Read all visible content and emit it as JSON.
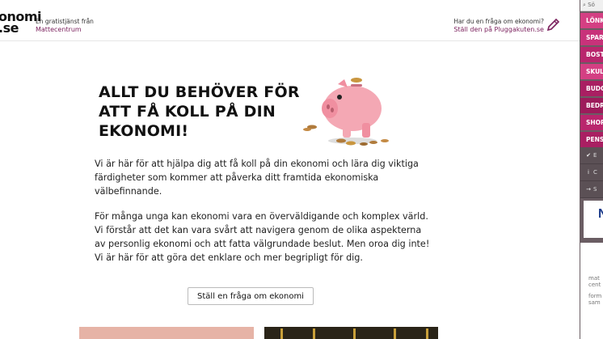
{
  "header": {
    "logo_line1": "onomi",
    "logo_line2": ".se",
    "tagline": "En gratistjänst från",
    "tagline_org": "Mattecentrum",
    "help_question": "Har du en fråga om ekonomi?",
    "help_link": "Ställ den på Pluggakuten.se"
  },
  "hero": {
    "title": "ALLT DU BEHÖVER FÖR ATT FÅ KOLL PÅ DIN EKONOMI!"
  },
  "main": {
    "paragraph1": "Vi är här för att hjälpa dig att få koll på din ekonomi och lära dig viktiga färdigheter som kommer att påverka ditt framtida ekonomiska välbefinnande.",
    "paragraph2": "För många unga kan ekonomi vara en överväldigande och komplex värld. Vi förstår att det kan vara svårt att navigera genom de olika aspekterna av personlig ekonomi och att fatta välgrundade beslut. Men oroa dig inte! Vi är här för att göra det enklare och mer begripligt för dig.",
    "cta_label": "Ställ en fråga om ekonomi"
  },
  "sidebar": {
    "search_text": "Sö",
    "tabs": [
      {
        "label": "LÖNK"
      },
      {
        "label": "SPAR"
      },
      {
        "label": "BOST"
      },
      {
        "label": "SKUL"
      },
      {
        "label": "BUDG"
      },
      {
        "label": "BEDR"
      },
      {
        "label": "SHOP"
      },
      {
        "label": "PENS"
      }
    ],
    "rows": [
      {
        "icon": "✔",
        "text": "E"
      },
      {
        "icon": "i",
        "text": "C"
      },
      {
        "icon": "→",
        "text": "S"
      }
    ],
    "logo_letter": "N",
    "bottom_text1": "mat cent",
    "bottom_text2": "form sam"
  },
  "colors": {
    "brand": "#7a1f5c",
    "tab_pink": "#c21f6a"
  }
}
